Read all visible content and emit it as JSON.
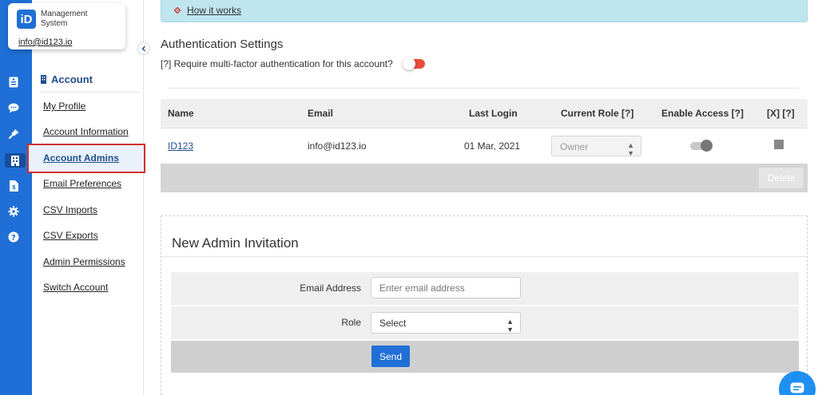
{
  "brand": {
    "badge": "iD",
    "line1": "Management",
    "line2": "System",
    "email": "info@id123.io"
  },
  "rail_icons": [
    "id-card-icon",
    "chat-icon",
    "plug-icon",
    "building-icon",
    "document-icon",
    "gear-icon",
    "help-icon"
  ],
  "sidebar": {
    "title": "Account",
    "items": [
      {
        "label": "My Profile"
      },
      {
        "label": "Account Information"
      },
      {
        "label": "Account Admins",
        "active": true
      },
      {
        "label": "Email Preferences"
      },
      {
        "label": "CSV Imports"
      },
      {
        "label": "CSV Exports"
      },
      {
        "label": "Admin Permissions"
      },
      {
        "label": "Switch Account"
      }
    ]
  },
  "banner": {
    "link": "How it works"
  },
  "auth": {
    "title": "Authentication Settings",
    "mfa_label": "[?] Require multi-factor authentication for this account?",
    "mfa_enabled": false
  },
  "admins_table": {
    "headers": {
      "name": "Name",
      "email": "Email",
      "last_login": "Last Login",
      "role": "Current Role [?]",
      "access": "Enable Access [?]",
      "remove": "[X] [?]"
    },
    "rows": [
      {
        "name": "ID123",
        "email": "info@id123.io",
        "last_login": "01 Mar, 2021",
        "role": "Owner",
        "access_enabled": true
      }
    ],
    "delete_label": "Delete"
  },
  "invite": {
    "title": "New Admin Invitation",
    "email_label": "Email Address",
    "email_placeholder": "Enter email address",
    "role_label": "Role",
    "role_value": "Select",
    "send_label": "Send"
  },
  "colors": {
    "rail": "#1f6fd6",
    "accent": "#1f4e8c",
    "toggle_off": "#e74c3c",
    "highlight_border": "#d0312d",
    "banner": "#bfe5ee"
  }
}
